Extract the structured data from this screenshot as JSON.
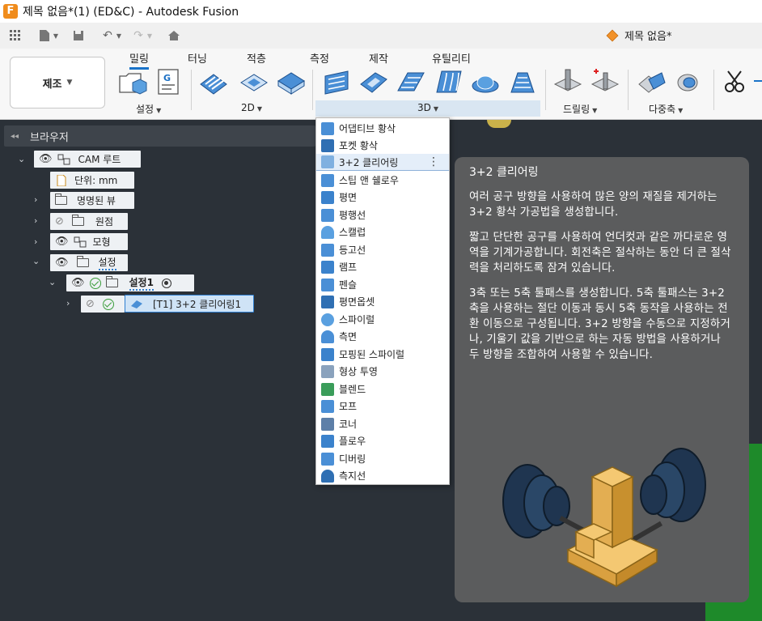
{
  "window": {
    "title": "제목 없음*(1) (ED&C) - Autodesk Fusion",
    "app_icon_letter": "F"
  },
  "quickbar": {
    "doc_tab_label": "제목 없음*"
  },
  "ribbon": {
    "workspace": "제조",
    "tabs": [
      "밀링",
      "터닝",
      "적층",
      "측정",
      "제작",
      "유틸리티"
    ],
    "groups": {
      "setup": "설정",
      "g2d": "2D",
      "g3d": "3D",
      "drilling": "드릴링",
      "multiaxis": "다중축"
    }
  },
  "browser": {
    "title": "브라우저",
    "nodes": {
      "cam_root": "CAM 루트",
      "units": "단위: mm",
      "named_views": "명명된 뷰",
      "origin": "원점",
      "model": "모형",
      "setups": "설정",
      "setup1": "설정1",
      "operation": "[T1] 3+2 클리어링1"
    }
  },
  "dropdown": {
    "items": [
      "어댑티브 황삭",
      "포켓 황삭",
      "3+2 클리어링",
      "스팁 앤 쉘로우",
      "평면",
      "평행선",
      "스캘럽",
      "등고선",
      "램프",
      "펜슬",
      "평면옵셋",
      "스파이럴",
      "측면",
      "모핑된 스파이럴",
      "형상 투영",
      "블렌드",
      "모프",
      "코너",
      "플로우",
      "디버링",
      "측지선"
    ],
    "highlighted_index": 2
  },
  "tooltip": {
    "title": "3+2 클리어링",
    "p1": "여러 공구 방향을 사용하여 많은 양의 재질을 제거하는 3+2 황삭 가공법을 생성합니다.",
    "p2": "짧고 단단한 공구를 사용하여 언더컷과 같은 까다로운 영역을 기계가공합니다. 회전축은 절삭하는 동안 더 큰 절삭력을 처리하도록 잠겨 있습니다.",
    "p3": "3축 또는 5축 툴패스를 생성합니다. 5축 툴패스는 3+2축을 사용하는 절단 이동과 동시 5축 동작을 사용하는 전환 이동으로 구성됩니다. 3+2 방향을 수동으로 지정하거나, 기울기 값을 기반으로 하는 자동 방법을 사용하거나 두 방향을 조합하여 사용할 수 있습니다."
  },
  "colors": {
    "canvas": "#2b3138",
    "accent": "#1a73c8",
    "part": "#e8b458",
    "tool_holder": "#1f3550"
  }
}
